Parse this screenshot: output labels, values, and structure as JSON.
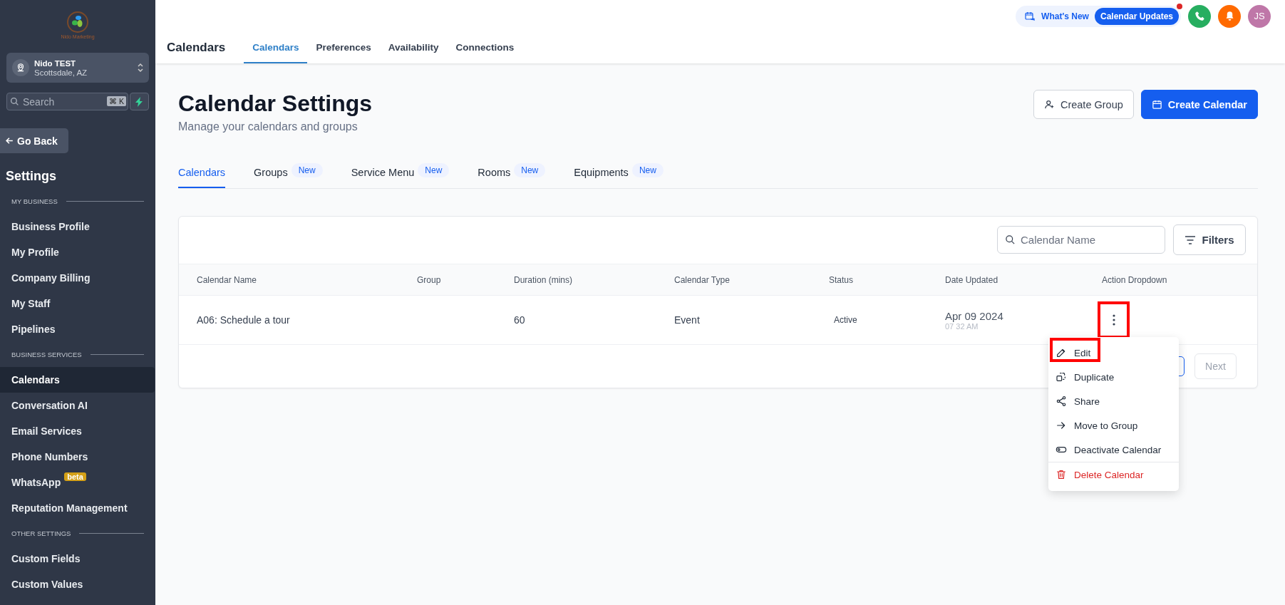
{
  "sidebar": {
    "logo_text": "Nido Marketing",
    "account": {
      "name": "Nido TEST",
      "location": "Scottsdale, AZ"
    },
    "search": {
      "placeholder": "Search",
      "shortcut": "⌘ K"
    },
    "back_button": "Go Back",
    "title": "Settings",
    "sections": [
      {
        "heading": "MY BUSINESS",
        "items": [
          {
            "label": "Business Profile",
            "selected": false
          },
          {
            "label": "My Profile",
            "selected": false
          },
          {
            "label": "Company Billing",
            "selected": false
          },
          {
            "label": "My Staff",
            "selected": false
          },
          {
            "label": "Pipelines",
            "selected": false
          }
        ]
      },
      {
        "heading": "BUSINESS SERVICES",
        "items": [
          {
            "label": "Calendars",
            "selected": true
          },
          {
            "label": "Conversation AI",
            "selected": false
          },
          {
            "label": "Email Services",
            "selected": false
          },
          {
            "label": "Phone Numbers",
            "selected": false
          },
          {
            "label": "WhatsApp",
            "selected": false,
            "badge": "beta"
          },
          {
            "label": "Reputation Management",
            "selected": false
          }
        ]
      },
      {
        "heading": "OTHER SETTINGS",
        "items": [
          {
            "label": "Custom Fields",
            "selected": false
          },
          {
            "label": "Custom Values",
            "selected": false
          }
        ]
      }
    ]
  },
  "header": {
    "title": "Calendars",
    "whats_new": "What's New",
    "updates": "Calendar Updates",
    "avatar": "JS",
    "tabs": [
      {
        "label": "Calendars",
        "selected": true
      },
      {
        "label": "Preferences",
        "selected": false
      },
      {
        "label": "Availability",
        "selected": false
      },
      {
        "label": "Connections",
        "selected": false
      }
    ]
  },
  "page": {
    "title": "Calendar Settings",
    "subtitle": "Manage your calendars and groups",
    "buttons": [
      {
        "label": "Create Group",
        "kind": "secondary"
      },
      {
        "label": "Create Calendar",
        "kind": "primary"
      }
    ],
    "tabs": [
      {
        "label": "Calendars",
        "selected": true
      },
      {
        "label": "Groups",
        "selected": false,
        "badge": "New"
      },
      {
        "label": "Service Menu",
        "selected": false,
        "badge": "New"
      },
      {
        "label": "Rooms",
        "selected": false,
        "badge": "New"
      },
      {
        "label": "Equipments",
        "selected": false,
        "badge": "New"
      }
    ]
  },
  "table": {
    "search": {
      "placeholder": "Calendar Name"
    },
    "filters": "Filters",
    "columns": [
      "Calendar Name",
      "Group",
      "Duration (mins)",
      "Calendar Type",
      "Status",
      "Date Updated",
      "Action Dropdown"
    ],
    "rows": [
      {
        "name": "A06: Schedule a tour",
        "duration": "60",
        "type": "Event",
        "status": "Active",
        "date": "Apr 09 2024",
        "time": "07 32 AM",
        "action_highlighted": true
      }
    ],
    "next": "Next"
  },
  "menu": {
    "items": [
      {
        "label": "Edit",
        "kind": "edit",
        "highlighted": true
      },
      {
        "label": "Duplicate",
        "kind": "duplicate",
        "highlighted": false
      },
      {
        "label": "Share",
        "kind": "share",
        "highlighted": false
      },
      {
        "label": "Move to Group",
        "kind": "move",
        "highlighted": false
      },
      {
        "label": "Deactivate Calendar",
        "kind": "toggle",
        "highlighted": false
      },
      {
        "label": "Delete Calendar",
        "kind": "delete",
        "highlighted": false
      }
    ]
  }
}
